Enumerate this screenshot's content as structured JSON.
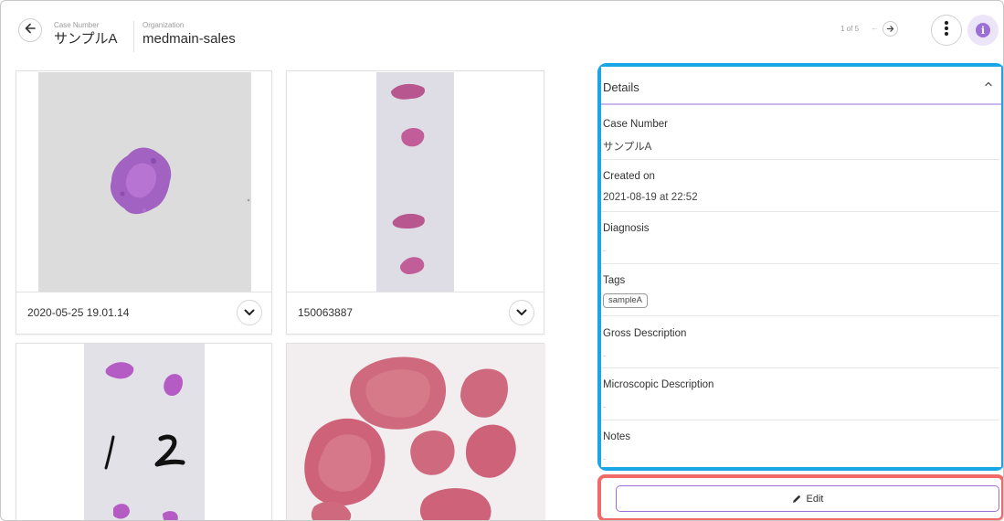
{
  "header": {
    "case_number_label": "Case Number",
    "case_number_value": "サンプルA",
    "organization_label": "Organization",
    "organization_value": "medmain-sales",
    "pager_text": "1 of 5",
    "pager_prev": "←"
  },
  "slides": [
    {
      "name": "2020-05-25 19.01.14"
    },
    {
      "name": "150063887"
    },
    {
      "name": ""
    },
    {
      "name": ""
    }
  ],
  "details": {
    "title": "Details",
    "fields": {
      "case_number": {
        "label": "Case Number",
        "value": "サンプルA"
      },
      "created_on": {
        "label": "Created on",
        "value": "2021-08-19 at 22:52"
      },
      "diagnosis": {
        "label": "Diagnosis",
        "value": "-"
      },
      "tags": {
        "label": "Tags",
        "tag": "sampleA"
      },
      "gross": {
        "label": "Gross Description",
        "value": "-"
      },
      "micro": {
        "label": "Microscopic Description",
        "value": "-"
      },
      "notes": {
        "label": "Notes",
        "value": "-"
      }
    }
  },
  "edit": {
    "label": "Edit"
  },
  "colors": {
    "accent_purple": "#9b6fd6",
    "highlight_blue": "#1aa6e6",
    "highlight_red": "#f06a6a",
    "tissue_pink": "#c04a7e"
  },
  "icons": {
    "back": "arrow-left-icon",
    "more": "more-vertical-icon",
    "info": "info-icon",
    "pager_next": "arrow-right-icon",
    "expand": "chevron-down-icon",
    "collapse": "chevron-up-icon",
    "edit": "pencil-icon"
  }
}
